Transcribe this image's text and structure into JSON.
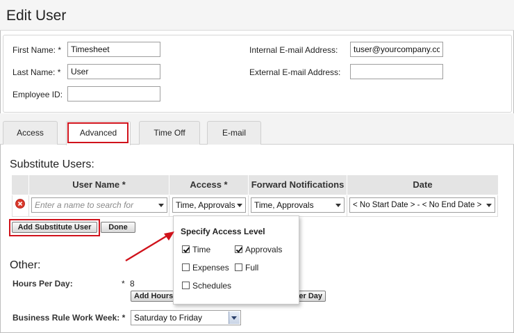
{
  "page": {
    "title": "Edit User"
  },
  "user_info": {
    "first_name_label": "First Name:",
    "first_name_value": "Timesheet",
    "last_name_label": "Last Name:",
    "last_name_value": "User",
    "employee_id_label": "Employee ID:",
    "employee_id_value": "",
    "required_mark": "*",
    "internal_email_label": "Internal E-mail Address:",
    "internal_email_value": "tuser@yourcompany.cc",
    "external_email_label": "External E-mail Address:",
    "external_email_value": ""
  },
  "tabs": [
    {
      "label": "Access"
    },
    {
      "label": "Advanced"
    },
    {
      "label": "Time Off"
    },
    {
      "label": "E-mail"
    }
  ],
  "substitute": {
    "title": "Substitute Users:",
    "columns": [
      "User Name *",
      "Access *",
      "Forward Notifications",
      "Date"
    ],
    "row": {
      "user_placeholder": "Enter a name to search for",
      "access": "Time, Approvals",
      "forward": "Time, Approvals",
      "date": "< No Start Date > - < No End Date >"
    },
    "add_button": "Add Substitute User",
    "done_button": "Done"
  },
  "access_popup": {
    "title": "Specify Access Level",
    "options": [
      {
        "label": "Time",
        "checked": true
      },
      {
        "label": "Approvals",
        "checked": true
      },
      {
        "label": "Expenses",
        "checked": false
      },
      {
        "label": "Full",
        "checked": false
      },
      {
        "label": "Schedules",
        "checked": false
      }
    ]
  },
  "other": {
    "title": "Other:",
    "hours_label": "Hours Per Day:",
    "hours_required": "*",
    "hours_value": "8",
    "add_hours_button_visible": "Add Hours",
    "per_day_button_visible": "er Day",
    "work_week_label": "Business Rule Work Week:",
    "work_week_required": "*",
    "work_week_value": "Saturday to Friday"
  },
  "colors": {
    "highlight": "#d0121b",
    "header_bg": "#f5f5f5",
    "grid_header": "#e4e4e4"
  }
}
